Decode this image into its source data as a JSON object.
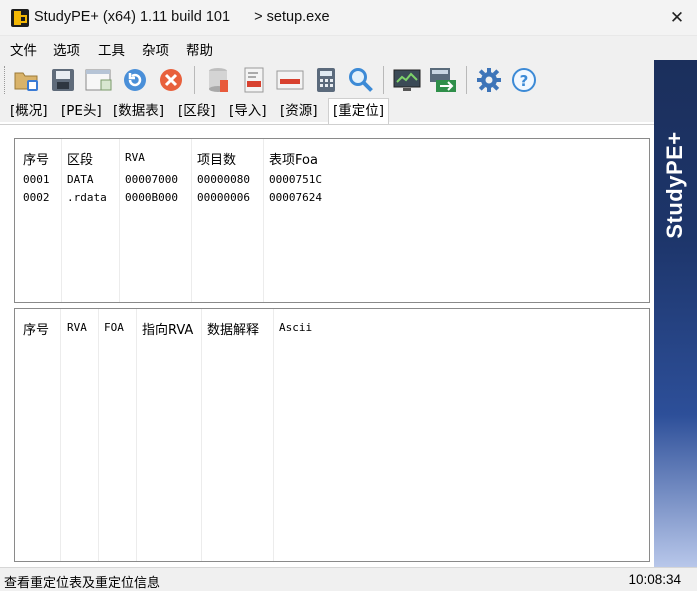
{
  "window": {
    "title": "StudyPE+ (x64) 1.11 build 101      > setup.exe",
    "close_glyph": "✕"
  },
  "menu": [
    "文件",
    "选项",
    "工具",
    "杂项",
    "帮助"
  ],
  "toolbar": {
    "icons": [
      "open-file-icon",
      "save-icon",
      "window-icon",
      "refresh-icon",
      "cancel-icon",
      "database-icon",
      "asm-icon",
      "hex-icon",
      "calculator-icon",
      "search-icon",
      "monitor-icon",
      "transfer-icon",
      "settings-icon",
      "help-icon"
    ],
    "help_glyph": "?"
  },
  "tabs": [
    {
      "label": "[概况]"
    },
    {
      "label": "[PE头]"
    },
    {
      "label": "[数据表]"
    },
    {
      "label": "[区段]"
    },
    {
      "label": "[导入]"
    },
    {
      "label": "[资源]"
    },
    {
      "label": "[重定位]",
      "active": true
    }
  ],
  "reloc_table": {
    "headers": [
      "序号",
      "区段",
      "RVA",
      "项目数",
      "表项Foa"
    ],
    "rows": [
      [
        "0001",
        "DATA",
        "00007000",
        "00000080",
        "0000751C"
      ],
      [
        "0002",
        ".rdata",
        "0000B000",
        "00000006",
        "00007624"
      ]
    ]
  },
  "detail_table": {
    "headers": [
      "序号",
      "RVA",
      "FOA",
      "指向RVA",
      "数据解释",
      "Ascii"
    ],
    "rows": []
  },
  "banner": "StudyPE+",
  "status": {
    "text": "查看重定位表及重定位信息",
    "time": "10:08:34"
  },
  "colors": {
    "banner_dark": "#1b2f5c",
    "banner_light": "#b8c7ea",
    "logo_yellow": "#f2b705"
  }
}
